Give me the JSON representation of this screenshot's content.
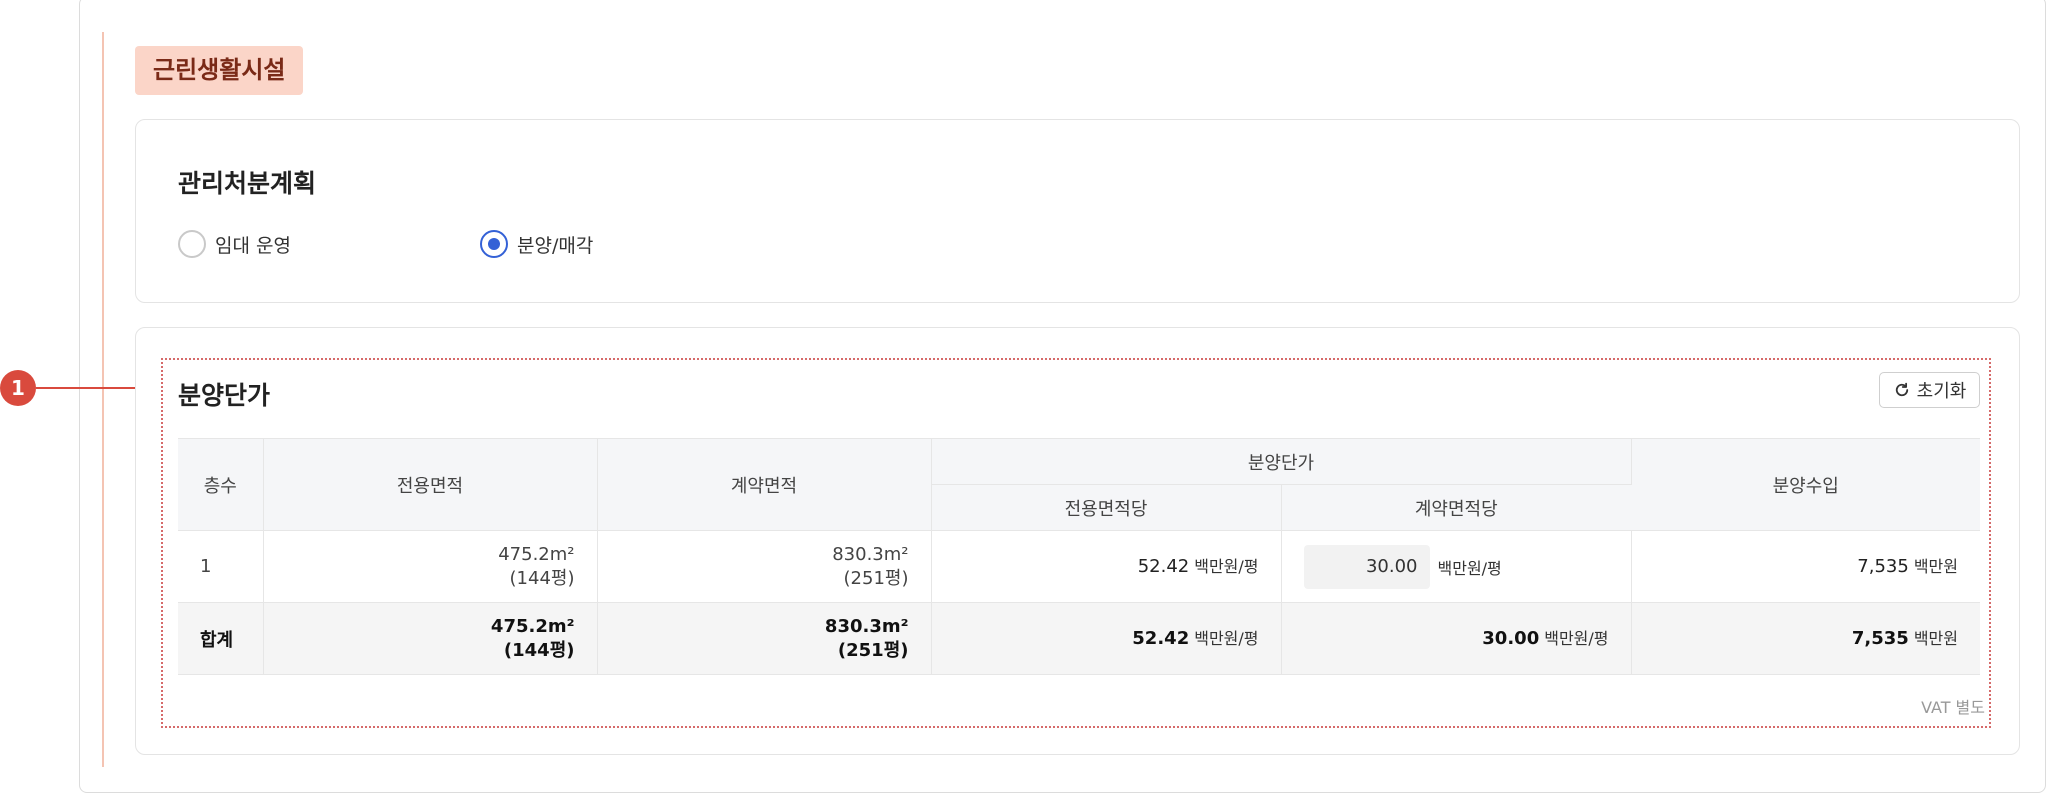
{
  "section_tag": "근린생활시설",
  "plan": {
    "title": "관리처분계획",
    "options": [
      {
        "label": "임대 운영",
        "selected": false
      },
      {
        "label": "분양/매각",
        "selected": true
      }
    ]
  },
  "marker_number": "1",
  "price": {
    "title": "분양단가",
    "reset_label": "초기화",
    "headers": {
      "floor": "층수",
      "exclusive_area": "전용면적",
      "contract_area": "계약면적",
      "unit_price_group": "분양단가",
      "per_exclusive": "전용면적당",
      "per_contract": "계약면적당",
      "revenue": "분양수입"
    },
    "rows": [
      {
        "floor": "1",
        "exclusive_area": "475.2m²",
        "exclusive_pyeong": "(144평)",
        "contract_area": "830.3m²",
        "contract_pyeong": "(251평)",
        "per_exclusive": "52.42",
        "per_contract_input": "30.00",
        "revenue": "7,535"
      }
    ],
    "total": {
      "label": "합계",
      "exclusive_area": "475.2m²",
      "exclusive_pyeong": "(144평)",
      "contract_area": "830.3m²",
      "contract_pyeong": "(251평)",
      "per_exclusive": "52.42",
      "per_contract": "30.00",
      "revenue": "7,535"
    },
    "units": {
      "per_pyeong": "백만원/평",
      "million": "백만원"
    },
    "vat_note": "VAT 별도"
  }
}
